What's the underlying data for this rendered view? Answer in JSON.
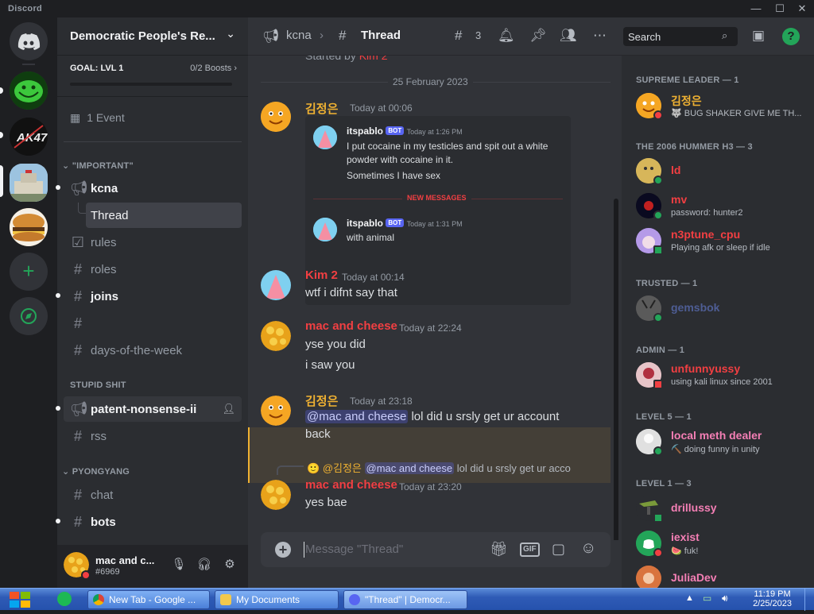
{
  "window": {
    "app_name": "Discord"
  },
  "guild": {
    "name": "Democratic People's Re...",
    "goal_title": "GOAL: LVL 1",
    "goal_boosts": "0/2 Boosts"
  },
  "events": {
    "label": "1 Event"
  },
  "categories": {
    "important": "\"IMPORTANT\"",
    "stupid": "STUPID SHIT",
    "pyongyang": "PYONGYANG"
  },
  "channels": {
    "kcna": "kcna",
    "thread": "Thread",
    "rules": "rules",
    "roles": "roles",
    "joins": "joins",
    "blank": "",
    "days": "days-of-the-week",
    "patent": "patent-nonsense-ii",
    "rss": "rss",
    "chat": "chat",
    "bots": "bots"
  },
  "user": {
    "name": "mac and c...",
    "tag": "#6969"
  },
  "header": {
    "channel": "kcna",
    "thread": "Thread",
    "thread_count": "3",
    "search_placeholder": "Search"
  },
  "chat": {
    "started_by": "Started by",
    "started_user": "Kim 2",
    "date_divider": "25 February 2023",
    "messages": [
      {
        "user": "김정은",
        "time": "Today at 00:06",
        "color": "#f0b232"
      },
      {
        "user": "Kim 2",
        "time": "Today at 00:14",
        "text": "wtf i difnt say that",
        "color": "#f23f42"
      },
      {
        "user": "mac and cheese",
        "time": "Today at 22:24",
        "text1": "yse you did",
        "text2": "i saw you",
        "color": "#f23f42"
      },
      {
        "user": "김정은",
        "time": "Today at 23:18",
        "mention": "@mac and cheese",
        "text1": " lol did u srsly get ur account",
        "text2": "back",
        "color": "#f0b232"
      },
      {
        "user": "mac and cheese",
        "time": "Today at 23:20",
        "text": "yes bae",
        "color": "#f23f42",
        "reply_user": "@김정은",
        "reply_mention": "@mac and cheese",
        "reply_text": "lol did u srsly get ur acco"
      }
    ],
    "embed": {
      "e1_user": "itspablo",
      "e1_bot": "BOT",
      "e1_time": "Today at 1:26 PM",
      "e1_line1": "I put cocaine in my testicles and spit out a white",
      "e1_line2": "powder with cocaine in it.",
      "e1_line3": "Sometimes I have sex",
      "new_messages": "NEW MESSAGES",
      "e2_user": "itspablo",
      "e2_bot": "BOT",
      "e2_time": "Today at 1:31 PM",
      "e2_line1": "with animal"
    },
    "composer_placeholder": "Message \"Thread\"",
    "gif_label": "GIF"
  },
  "members": {
    "groups": [
      {
        "title": "SUPREME LEADER — 1"
      },
      {
        "title": "THE 2006 HUMMER H3 — 3"
      },
      {
        "title": "TRUSTED — 1"
      },
      {
        "title": "ADMIN — 1"
      },
      {
        "title": "LEVEL 5 — 1"
      },
      {
        "title": "LEVEL 1 — 3"
      }
    ],
    "list": [
      {
        "name": "김정은",
        "sub": "🐺 BUG SHAKER GIVE ME TH...",
        "color": "#f0b232"
      },
      {
        "name": "ld",
        "sub": "",
        "color": "#f23f42"
      },
      {
        "name": "mv",
        "sub": "password: hunter2",
        "color": "#f23f42"
      },
      {
        "name": "n3ptune_cpu",
        "sub": "Playing afk or sleep if idle",
        "color": "#f23f42"
      },
      {
        "name": "gemsbok",
        "sub": "",
        "color": "#4e5d94"
      },
      {
        "name": "unfunnyussy",
        "sub": "using kali linux since 2001",
        "color": "#f23f42"
      },
      {
        "name": "local meth dealer",
        "sub": "⛏️ doing funny in unity",
        "color": "#f47fb5"
      },
      {
        "name": "drillussy",
        "sub": "",
        "color": "#f47fb5"
      },
      {
        "name": "iexist",
        "sub": "🍉 fuk!",
        "color": "#f47fb5"
      },
      {
        "name": "JuliaDev",
        "sub": "",
        "color": "#f47fb5"
      }
    ]
  },
  "taskbar": {
    "items": [
      "New Tab - Google ...",
      "My Documents",
      "\"Thread\" | Democr..."
    ],
    "time": "11:19 PM",
    "date": "2/25/2023"
  }
}
